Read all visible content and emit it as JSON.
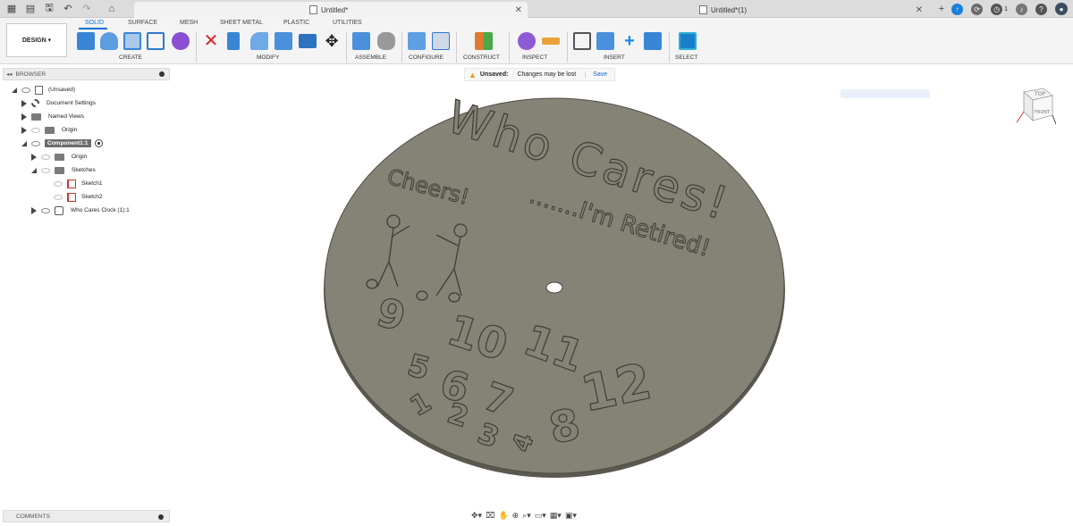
{
  "tabs": [
    {
      "title": "Untitled*",
      "active": true
    },
    {
      "title": "Untitled*(1)",
      "active": false
    }
  ],
  "topright": {
    "job_count": "1"
  },
  "toolbar": {
    "design_label": "DESIGN",
    "workspace_tabs": [
      "SOLID",
      "SURFACE",
      "MESH",
      "SHEET METAL",
      "PLASTIC",
      "UTILITIES"
    ],
    "groups": [
      "CREATE",
      "MODIFY",
      "ASSEMBLE",
      "CONFIGURE",
      "CONSTRUCT",
      "INSPECT",
      "INSERT",
      "SELECT"
    ]
  },
  "banner": {
    "label": "Unsaved:",
    "message": "Changes may be lost",
    "action": "Save"
  },
  "browser": {
    "title": "BROWSER",
    "root": "(Unsaved)",
    "items": [
      "Document Settings",
      "Named Views",
      "Origin",
      "Component1:1",
      "Origin",
      "Sketches",
      "Sketch1",
      "Sketch2",
      "Who Cares Clock (1):1"
    ]
  },
  "comments": {
    "title": "COMMENTS"
  },
  "model": {
    "title_text": "Who Cares!",
    "cheers_text": "Cheers!",
    "retired_text": ".......I'm Retired!",
    "numbers": [
      "9",
      "10",
      "11",
      "12",
      "5",
      "6",
      "7",
      "8",
      "1",
      "2",
      "3",
      "4"
    ]
  },
  "viewcube": {
    "top": "TOP",
    "front": "FRONT"
  },
  "colors": {
    "accent": "#0d6fcf",
    "disk": "#858376",
    "disk_edge": "#5a584f",
    "warning": "#e79d22"
  }
}
